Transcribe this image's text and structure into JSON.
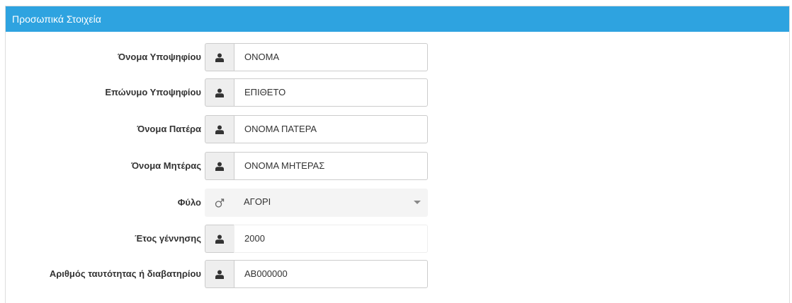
{
  "panel": {
    "title": "Προσωπικά Στοιχεία"
  },
  "form": {
    "first_name": {
      "label": "Όνομα Υποψηφίου",
      "value": "ΟΝΟΜΑ",
      "icon": "user-icon"
    },
    "last_name": {
      "label": "Επώνυμο Υποψηφίου",
      "value": "ΕΠΙΘΕΤΟ",
      "icon": "user-icon"
    },
    "father_name": {
      "label": "Όνομα Πατέρα",
      "value": "ΟΝΟΜΑ ΠΑΤΕΡΑ",
      "icon": "user-icon"
    },
    "mother_name": {
      "label": "Όνομα Μητέρας",
      "value": "ΟΝΟΜΑ ΜΗΤΕΡΑΣ",
      "icon": "user-icon"
    },
    "gender": {
      "label": "Φύλο",
      "value": "ΑΓΟΡΙ",
      "icon": "male-symbol-icon"
    },
    "birth_year": {
      "label": "Έτος γέννησης",
      "value": "2000",
      "icon": "user-icon"
    },
    "id_number": {
      "label": "Αριθμός ταυτότητας ή διαβατηρίου",
      "value": "ΑΒ000000",
      "icon": "user-icon"
    }
  },
  "colors": {
    "header": "#2ea3e0",
    "addon": "#eeeeee",
    "border": "#cccccc"
  }
}
